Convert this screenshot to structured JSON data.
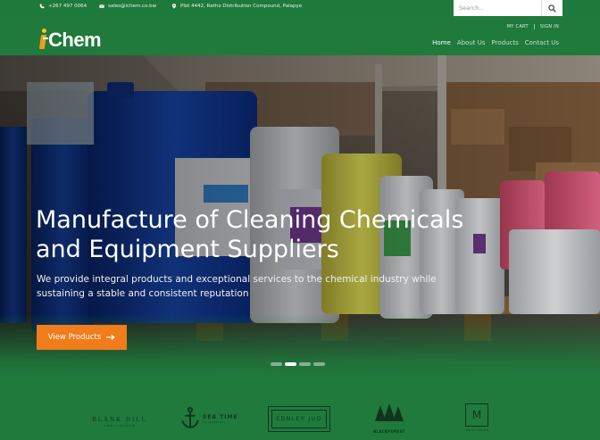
{
  "topbar": {
    "phone": "+267 497 0064",
    "email": "sales@ichem.co.bw",
    "address": "Plot 4442, Ratho Distribution Compound, Palapye",
    "search_placeholder": "Search..."
  },
  "header": {
    "logo_text": "Chem",
    "account": {
      "cart": "MY CART",
      "signin": "SIGN IN"
    },
    "nav": [
      "Home",
      "About Us",
      "Products",
      "Contact Us"
    ],
    "active_nav": "Home"
  },
  "hero": {
    "title": "Manufacture of Cleaning Chemicals and Equipment Suppliers",
    "subtitle": "We provide integral products and exceptional services to the chemical industry while sustaining a stable and consistent reputation",
    "cta": "View Products",
    "slides": 4,
    "active_slide": 2
  },
  "brands": [
    {
      "name": "BLANK HILL",
      "tagline": "ABBOTSFIELD"
    },
    {
      "name": "SEA TIME",
      "tagline": "CLOTHING"
    },
    {
      "name": "EDNLEY JUD"
    },
    {
      "name": "BLACKFOREST"
    },
    {
      "name": "M",
      "tagline": "NORTHERN"
    }
  ],
  "colors": {
    "brand_green": "#1f7a3c",
    "accent_orange": "#f07c1c",
    "logo_yellow": "#f6c21a"
  }
}
